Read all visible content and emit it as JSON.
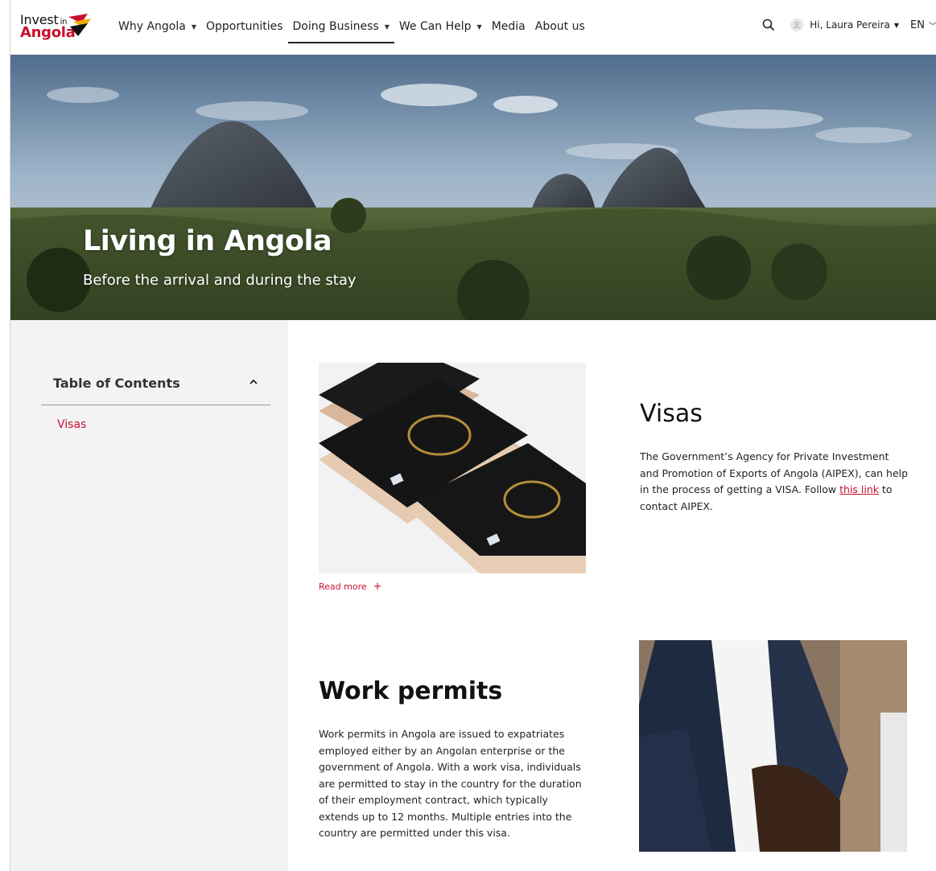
{
  "brand": {
    "logo_line1": "Invest",
    "logo_in": "in",
    "logo_line2": "Angola",
    "colors": {
      "accent": "#c8102e",
      "sidebar_bg": "#f3f3f3"
    }
  },
  "nav": {
    "items": [
      {
        "label": "Why Angola",
        "has_dropdown": true
      },
      {
        "label": "Opportunities",
        "has_dropdown": false
      },
      {
        "label": "Doing Business",
        "has_dropdown": true,
        "active": true
      },
      {
        "label": "We Can Help",
        "has_dropdown": true
      },
      {
        "label": "Media",
        "has_dropdown": false
      },
      {
        "label": "About us",
        "has_dropdown": false
      }
    ]
  },
  "header_right": {
    "search_icon": "search-icon",
    "user_greeting": "Hi, Laura Pereira",
    "language": "EN"
  },
  "hero": {
    "title": "Living in Angola",
    "subtitle": "Before the arrival and during the stay"
  },
  "toc": {
    "title": "Table of Contents",
    "items": [
      "Visas"
    ]
  },
  "visas": {
    "title": "Visas",
    "text_before_link": "The Government’s Agency for Private Investment and Promotion of Exports of Angola (AIPEX), can help in the process of getting a VISA. Follow ",
    "link_text": "this link",
    "text_after_link": " to contact AIPEX.",
    "read_more": "Read more",
    "read_more_icon": "+"
  },
  "work_permits": {
    "title": "Work permits",
    "text": "Work permits in Angola are issued to expatriates employed either by an Angolan enterprise or the government of Angola. With a work visa, individuals are permitted to stay in the country for the duration of their employment contract, which typically extends up to 12 months. Multiple entries into the country are permitted under this visa."
  }
}
